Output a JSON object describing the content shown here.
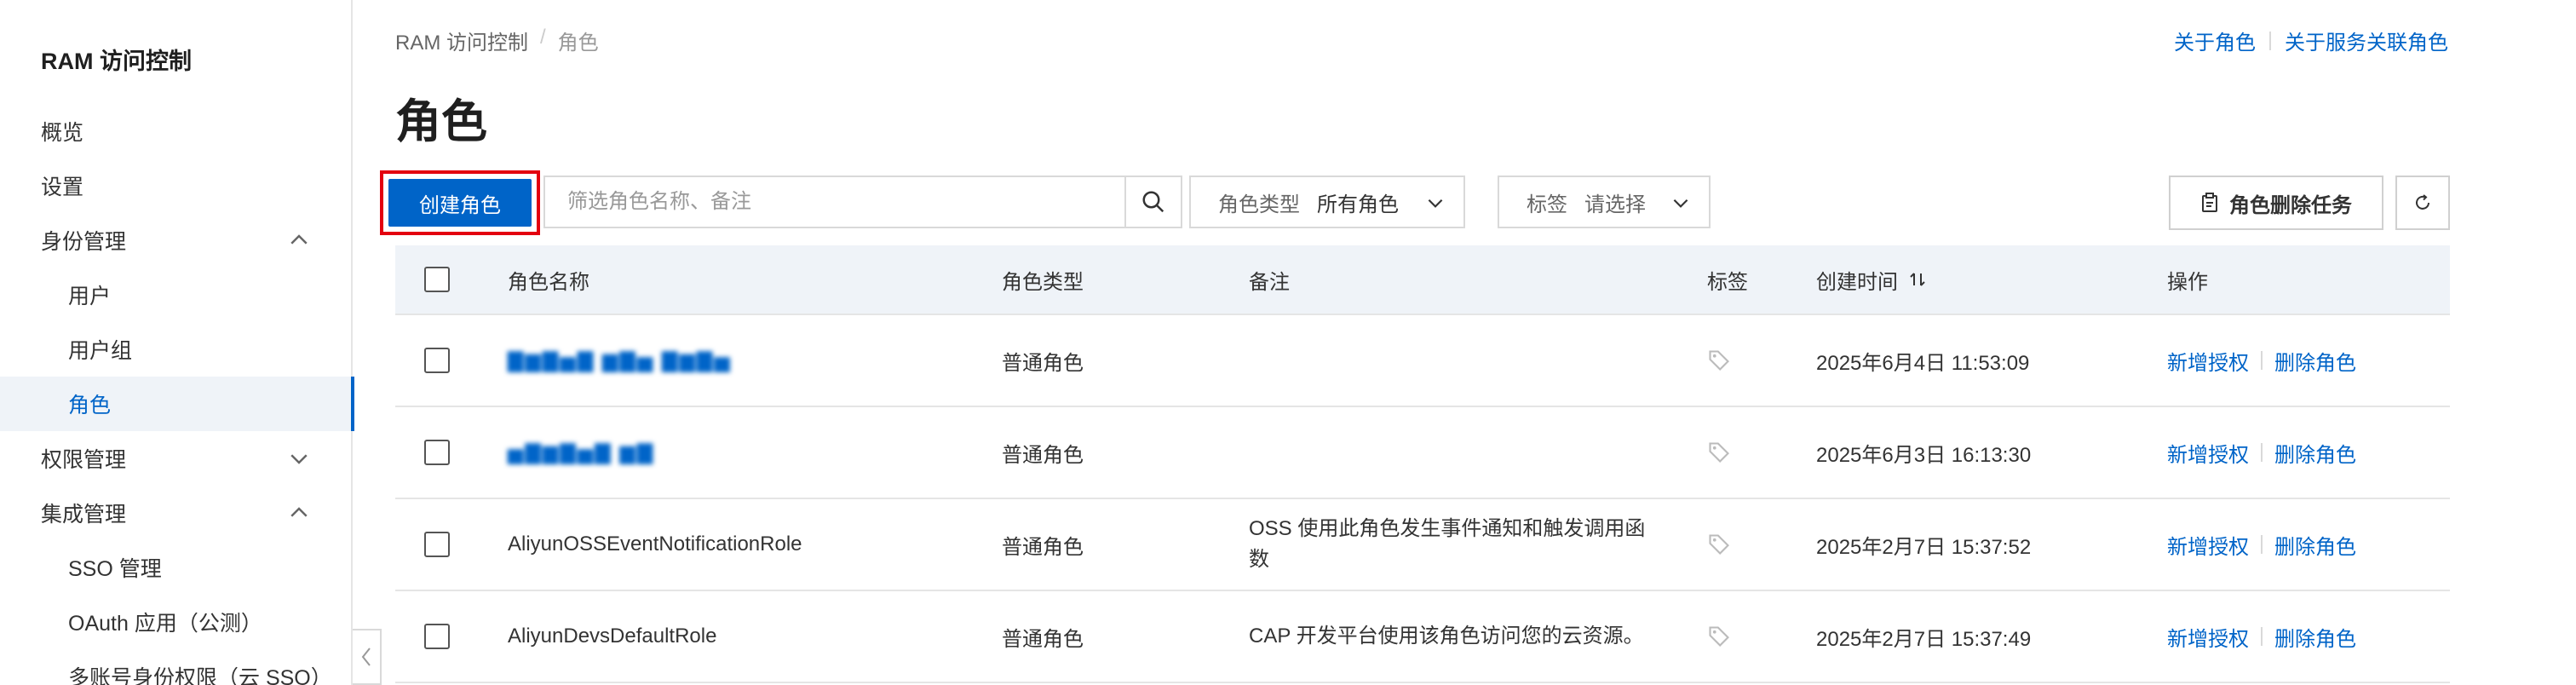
{
  "sidebar": {
    "title": "RAM 访问控制",
    "items": [
      {
        "label": "概览"
      },
      {
        "label": "设置"
      },
      {
        "label": "身份管理"
      },
      {
        "label": "用户"
      },
      {
        "label": "用户组"
      },
      {
        "label": "角色"
      },
      {
        "label": "权限管理"
      },
      {
        "label": "集成管理"
      },
      {
        "label": "SSO 管理"
      },
      {
        "label": "OAuth 应用（公测）"
      },
      {
        "label": "多账号身份权限（云 SSO）"
      }
    ]
  },
  "breadcrumb": {
    "root": "RAM 访问控制",
    "sep": "/",
    "current": "角色"
  },
  "top_links": {
    "about_role": "关于角色",
    "about_service_role": "关于服务关联角色"
  },
  "page_title": "角色",
  "toolbar": {
    "create_label": "创建角色",
    "search_placeholder": "筛选角色名称、备注",
    "role_type_label": "角色类型",
    "role_type_value": "所有角色",
    "tag_label": "标签",
    "tag_value": "请选择",
    "delete_task_label": "角色删除任务"
  },
  "table": {
    "headers": {
      "name": "角色名称",
      "type": "角色类型",
      "note": "备注",
      "tag": "标签",
      "created": "创建时间",
      "ops": "操作"
    },
    "rows": [
      {
        "type": "普通角色",
        "note": "",
        "created": "2025年6月4日 11:53:09",
        "op_grant": "新增授权",
        "op_delete": "删除角色"
      },
      {
        "type": "普通角色",
        "note": "",
        "created": "2025年6月3日 16:13:30",
        "op_grant": "新增授权",
        "op_delete": "删除角色"
      },
      {
        "name": "AliyunOSSEventNotificationRole",
        "type": "普通角色",
        "note": "OSS 使用此角色发生事件通知和触发调用函数",
        "created": "2025年2月7日 15:37:52",
        "op_grant": "新增授权",
        "op_delete": "删除角色"
      },
      {
        "name": "AliyunDevsDefaultRole",
        "type": "普通角色",
        "note": "CAP 开发平台使用该角色访问您的云资源。",
        "created": "2025年2月7日 15:37:49",
        "op_grant": "新增授权",
        "op_delete": "删除角色"
      }
    ]
  },
  "icons": [
    "chevron-up-icon",
    "chevron-down-icon",
    "search-icon",
    "tag-icon",
    "sort-icon",
    "clipboard-icon",
    "refresh-icon",
    "chevron-left-icon"
  ],
  "colors": {
    "primary": "#0064c8",
    "highlight_border": "#e3000f",
    "active_bg": "#eff3f8",
    "header_bg": "#eff3f8"
  }
}
